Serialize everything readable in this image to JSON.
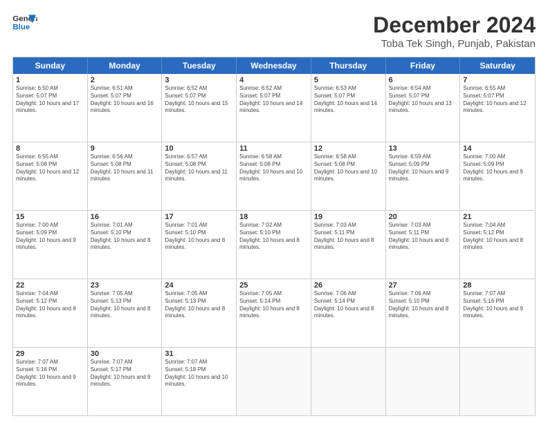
{
  "logo": {
    "line1": "General",
    "line2": "Blue"
  },
  "title": "December 2024",
  "subtitle": "Toba Tek Singh, Punjab, Pakistan",
  "weekdays": [
    "Sunday",
    "Monday",
    "Tuesday",
    "Wednesday",
    "Thursday",
    "Friday",
    "Saturday"
  ],
  "weeks": [
    [
      {
        "day": "1",
        "sunrise": "Sunrise: 6:50 AM",
        "sunset": "Sunset: 5:07 PM",
        "daylight": "Daylight: 10 hours and 17 minutes."
      },
      {
        "day": "2",
        "sunrise": "Sunrise: 6:51 AM",
        "sunset": "Sunset: 5:07 PM",
        "daylight": "Daylight: 10 hours and 16 minutes."
      },
      {
        "day": "3",
        "sunrise": "Sunrise: 6:52 AM",
        "sunset": "Sunset: 5:07 PM",
        "daylight": "Daylight: 10 hours and 15 minutes."
      },
      {
        "day": "4",
        "sunrise": "Sunrise: 6:52 AM",
        "sunset": "Sunset: 5:07 PM",
        "daylight": "Daylight: 10 hours and 14 minutes."
      },
      {
        "day": "5",
        "sunrise": "Sunrise: 6:53 AM",
        "sunset": "Sunset: 5:07 PM",
        "daylight": "Daylight: 10 hours and 14 minutes."
      },
      {
        "day": "6",
        "sunrise": "Sunrise: 6:54 AM",
        "sunset": "Sunset: 5:07 PM",
        "daylight": "Daylight: 10 hours and 13 minutes."
      },
      {
        "day": "7",
        "sunrise": "Sunrise: 6:55 AM",
        "sunset": "Sunset: 5:07 PM",
        "daylight": "Daylight: 10 hours and 12 minutes."
      }
    ],
    [
      {
        "day": "8",
        "sunrise": "Sunrise: 6:55 AM",
        "sunset": "Sunset: 5:08 PM",
        "daylight": "Daylight: 10 hours and 12 minutes."
      },
      {
        "day": "9",
        "sunrise": "Sunrise: 6:56 AM",
        "sunset": "Sunset: 5:08 PM",
        "daylight": "Daylight: 10 hours and 11 minutes."
      },
      {
        "day": "10",
        "sunrise": "Sunrise: 6:57 AM",
        "sunset": "Sunset: 5:08 PM",
        "daylight": "Daylight: 10 hours and 11 minutes."
      },
      {
        "day": "11",
        "sunrise": "Sunrise: 6:58 AM",
        "sunset": "Sunset: 5:08 PM",
        "daylight": "Daylight: 10 hours and 10 minutes."
      },
      {
        "day": "12",
        "sunrise": "Sunrise: 6:58 AM",
        "sunset": "Sunset: 5:08 PM",
        "daylight": "Daylight: 10 hours and 10 minutes."
      },
      {
        "day": "13",
        "sunrise": "Sunrise: 6:59 AM",
        "sunset": "Sunset: 5:09 PM",
        "daylight": "Daylight: 10 hours and 9 minutes."
      },
      {
        "day": "14",
        "sunrise": "Sunrise: 7:00 AM",
        "sunset": "Sunset: 5:09 PM",
        "daylight": "Daylight: 10 hours and 9 minutes."
      }
    ],
    [
      {
        "day": "15",
        "sunrise": "Sunrise: 7:00 AM",
        "sunset": "Sunset: 5:09 PM",
        "daylight": "Daylight: 10 hours and 9 minutes."
      },
      {
        "day": "16",
        "sunrise": "Sunrise: 7:01 AM",
        "sunset": "Sunset: 5:10 PM",
        "daylight": "Daylight: 10 hours and 8 minutes."
      },
      {
        "day": "17",
        "sunrise": "Sunrise: 7:01 AM",
        "sunset": "Sunset: 5:10 PM",
        "daylight": "Daylight: 10 hours and 8 minutes."
      },
      {
        "day": "18",
        "sunrise": "Sunrise: 7:02 AM",
        "sunset": "Sunset: 5:10 PM",
        "daylight": "Daylight: 10 hours and 8 minutes."
      },
      {
        "day": "19",
        "sunrise": "Sunrise: 7:03 AM",
        "sunset": "Sunset: 5:11 PM",
        "daylight": "Daylight: 10 hours and 8 minutes."
      },
      {
        "day": "20",
        "sunrise": "Sunrise: 7:03 AM",
        "sunset": "Sunset: 5:11 PM",
        "daylight": "Daylight: 10 hours and 8 minutes."
      },
      {
        "day": "21",
        "sunrise": "Sunrise: 7:04 AM",
        "sunset": "Sunset: 5:12 PM",
        "daylight": "Daylight: 10 hours and 8 minutes."
      }
    ],
    [
      {
        "day": "22",
        "sunrise": "Sunrise: 7:04 AM",
        "sunset": "Sunset: 5:12 PM",
        "daylight": "Daylight: 10 hours and 8 minutes."
      },
      {
        "day": "23",
        "sunrise": "Sunrise: 7:05 AM",
        "sunset": "Sunset: 5:13 PM",
        "daylight": "Daylight: 10 hours and 8 minutes."
      },
      {
        "day": "24",
        "sunrise": "Sunrise: 7:05 AM",
        "sunset": "Sunset: 5:13 PM",
        "daylight": "Daylight: 10 hours and 8 minutes."
      },
      {
        "day": "25",
        "sunrise": "Sunrise: 7:05 AM",
        "sunset": "Sunset: 5:14 PM",
        "daylight": "Daylight: 10 hours and 8 minutes."
      },
      {
        "day": "26",
        "sunrise": "Sunrise: 7:06 AM",
        "sunset": "Sunset: 5:14 PM",
        "daylight": "Daylight: 10 hours and 8 minutes."
      },
      {
        "day": "27",
        "sunrise": "Sunrise: 7:06 AM",
        "sunset": "Sunset: 5:15 PM",
        "daylight": "Daylight: 10 hours and 8 minutes."
      },
      {
        "day": "28",
        "sunrise": "Sunrise: 7:07 AM",
        "sunset": "Sunset: 5:16 PM",
        "daylight": "Daylight: 10 hours and 9 minutes."
      }
    ],
    [
      {
        "day": "29",
        "sunrise": "Sunrise: 7:07 AM",
        "sunset": "Sunset: 5:16 PM",
        "daylight": "Daylight: 10 hours and 9 minutes."
      },
      {
        "day": "30",
        "sunrise": "Sunrise: 7:07 AM",
        "sunset": "Sunset: 5:17 PM",
        "daylight": "Daylight: 10 hours and 9 minutes."
      },
      {
        "day": "31",
        "sunrise": "Sunrise: 7:07 AM",
        "sunset": "Sunset: 5:18 PM",
        "daylight": "Daylight: 10 hours and 10 minutes."
      },
      null,
      null,
      null,
      null
    ]
  ]
}
